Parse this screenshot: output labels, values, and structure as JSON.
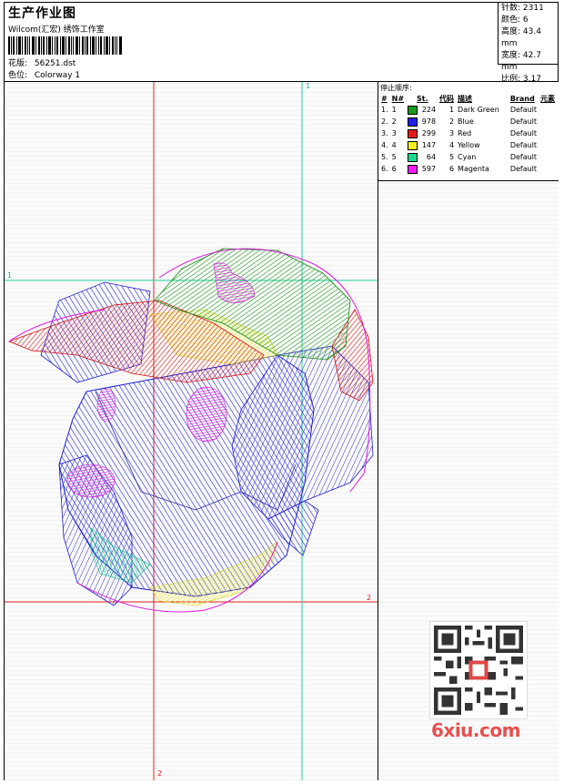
{
  "header": {
    "title": "生产作业图",
    "subtitle": "Wilcom(汇宏) 绣饰工作室",
    "design_label": "花版:",
    "design_value": "56251.dst",
    "colorway_label": "色位:",
    "colorway_value": "Colorway 1"
  },
  "stats": {
    "stitches": "针数: 2311",
    "colors": "颜色: 6",
    "height": "高度: 43.4 mm",
    "width": "宽度: 42.7 mm",
    "ratio": "比例: 3.17"
  },
  "axes": {
    "top_label": "1",
    "left_label": "1",
    "right_label": "2",
    "bottom_label": "2"
  },
  "legend": {
    "title": "停止顺序:",
    "columns": [
      "#",
      "N#",
      "St.",
      "代码",
      "描述",
      "Brand",
      "元素"
    ],
    "rows": [
      {
        "num": "1.",
        "n": "1",
        "st": "224",
        "code": "1",
        "desc": "Dark Green",
        "brand": "Default",
        "color": "#1a9a1a"
      },
      {
        "num": "2.",
        "n": "2",
        "st": "978",
        "code": "2",
        "desc": "Blue",
        "brand": "Default",
        "color": "#1f1fe6"
      },
      {
        "num": "3.",
        "n": "3",
        "st": "299",
        "code": "3",
        "desc": "Red",
        "brand": "Default",
        "color": "#e61a1a"
      },
      {
        "num": "4.",
        "n": "4",
        "st": "147",
        "code": "4",
        "desc": "Yellow",
        "brand": "Default",
        "color": "#f2f21a"
      },
      {
        "num": "5.",
        "n": "5",
        "st": "64",
        "code": "5",
        "desc": "Cyan",
        "brand": "Default",
        "color": "#1ad98c"
      },
      {
        "num": "6.",
        "n": "6",
        "st": "597",
        "code": "6",
        "desc": "Magenta",
        "brand": "Default",
        "color": "#f21af2"
      }
    ]
  },
  "watermark": {
    "text": "6xiu.com",
    "color": "#e85050"
  }
}
